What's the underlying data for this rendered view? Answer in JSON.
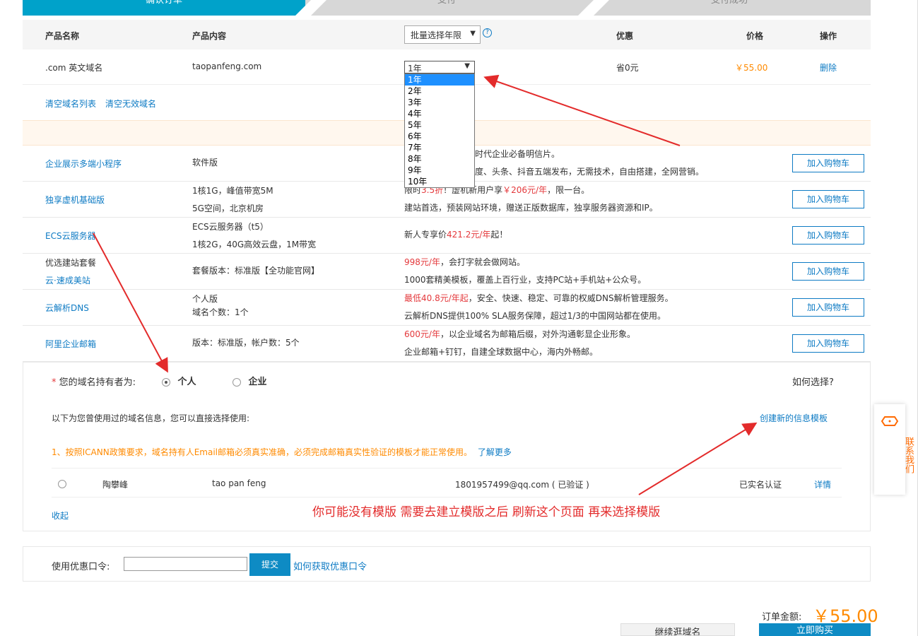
{
  "steps": [
    "确认订单",
    "支付",
    "支付成功"
  ],
  "table_header": {
    "name": "产品名称",
    "content": "产品内容",
    "batch_select": "批量选择年限",
    "discount": "优惠",
    "price": "价格",
    "action": "操作",
    "help_icon": "question-circle-icon"
  },
  "order_item": {
    "name": ".com 英文域名",
    "domain": "taopanfeng.com",
    "years_selected": "1年",
    "discount": "省0元",
    "price": "￥55.00",
    "delete": "删除"
  },
  "year_options": [
    "1年",
    "2年",
    "3年",
    "4年",
    "5年",
    "6年",
    "7年",
    "8年",
    "9年",
    "10年"
  ],
  "list_actions": {
    "clear_list": "清空域名列表",
    "clear_invalid": "清空无效域名"
  },
  "recommendations": [
    {
      "name": "企业展示多端小程序",
      "content": [
        "软件版"
      ],
      "desc1": {
        "pre": "",
        "red": "",
        "post": "时代企业必备明信片。"
      },
      "desc2": {
        "pre": "",
        "red": "",
        "post": "度、头条、抖音五端发布，无需技术，自由搭建，全网营销。"
      },
      "btn": "加入购物车"
    },
    {
      "name": "独享虚机基础版",
      "content": [
        "1核1G，峰值带宽5M",
        "5G空间，北京机房"
      ],
      "desc1": {
        "pre": "限时",
        "red": "3.5折",
        "post": "！虚机新用户享",
        "red2": "￥206元/年",
        "post2": "，限一台。"
      },
      "desc2": {
        "pre": "建站首选，预装网站环境，赠送正版数据库，独享服务器资源和IP。",
        "red": "",
        "post": ""
      },
      "btn": "加入购物车"
    },
    {
      "name": "ECS云服务器",
      "content": [
        "ECS云服务器（t5）",
        "1核2G，40G高效云盘，1M带宽"
      ],
      "desc1": {
        "pre": "新人专享价",
        "red": "421.2元/年",
        "post": "起！"
      },
      "desc2": {
        "pre": "",
        "red": "",
        "post": ""
      },
      "btn": "加入购物车"
    },
    {
      "name": "优选建站套餐",
      "name2": "云·速成美站",
      "content": [
        "套餐版本：标准版【全功能官网】"
      ],
      "desc1": {
        "pre": "",
        "red": "998元/年",
        "post": "，会打字就会做网站。"
      },
      "desc2": {
        "pre": "1000套精美模板，覆盖上百行业，支持PC站+手机站+公众号。",
        "red": "",
        "post": ""
      },
      "btn": "加入购物车"
    },
    {
      "name": "云解析DNS",
      "content": [
        "个人版",
        "域名个数：1个"
      ],
      "desc1": {
        "pre": "",
        "red": "最低40.8元/年起",
        "post": "，安全、快速、稳定、可靠的权威DNS解析管理服务。"
      },
      "desc2": {
        "pre": "云解析DNS提供100% SLA服务保障，超过1/3的中国网站都在使用。",
        "red": "",
        "post": ""
      },
      "btn": "加入购物车"
    },
    {
      "name": "阿里企业邮箱",
      "content": [
        "版本：标准版，帐户数：5个"
      ],
      "desc1": {
        "pre": "",
        "red": "600元/年",
        "post": "，以企业域名为邮箱后缀，对外沟通彰显企业形象。"
      },
      "desc2": {
        "pre": "企业邮箱+钉钉，自建全球数据中心，海内外畅邮。",
        "red": "",
        "post": ""
      },
      "btn": "加入购物车"
    }
  ],
  "owner": {
    "required_mark": "*",
    "label": "您的域名持有者为:",
    "option_personal": "个人",
    "option_company": "企业",
    "how_to_choose": "如何选择?",
    "used_info_text": "以下为您曾使用过的域名信息，您可以直接选择使用:",
    "create_template": "创建新的信息模板",
    "icann_notice": "1、按照ICANN政策要求，域名持有人Email邮箱必须真实准确，必须完成邮箱真实性验证的模板才能正常使用。",
    "learn_more": "了解更多",
    "template": {
      "name": "陶攀峰",
      "pinyin": "tao pan feng",
      "email": "1801957499@qq.com ( 已验证 )",
      "status": "已实名认证",
      "detail": "详情"
    },
    "collapse": "收起"
  },
  "annotation_note": "你可能没有模版 需要去建立模版之后 刷新这个页面 再来选择模版",
  "coupon": {
    "label": "使用优惠口令:",
    "value": "",
    "submit": "提交",
    "how_to_get": "如何获取优惠口令"
  },
  "total": {
    "label": "订单金额:",
    "amount": "￥55.00"
  },
  "footer_buttons": {
    "continue": "继续逛域名",
    "pay": "立即购买"
  },
  "contact": {
    "label": "联系我们",
    "icon": "chat-bubble-icon"
  },
  "colors": {
    "primary": "#0e7bc4",
    "accent_red": "#e4393c",
    "orange": "#ff8a00",
    "step_active": "#00a2ca"
  }
}
